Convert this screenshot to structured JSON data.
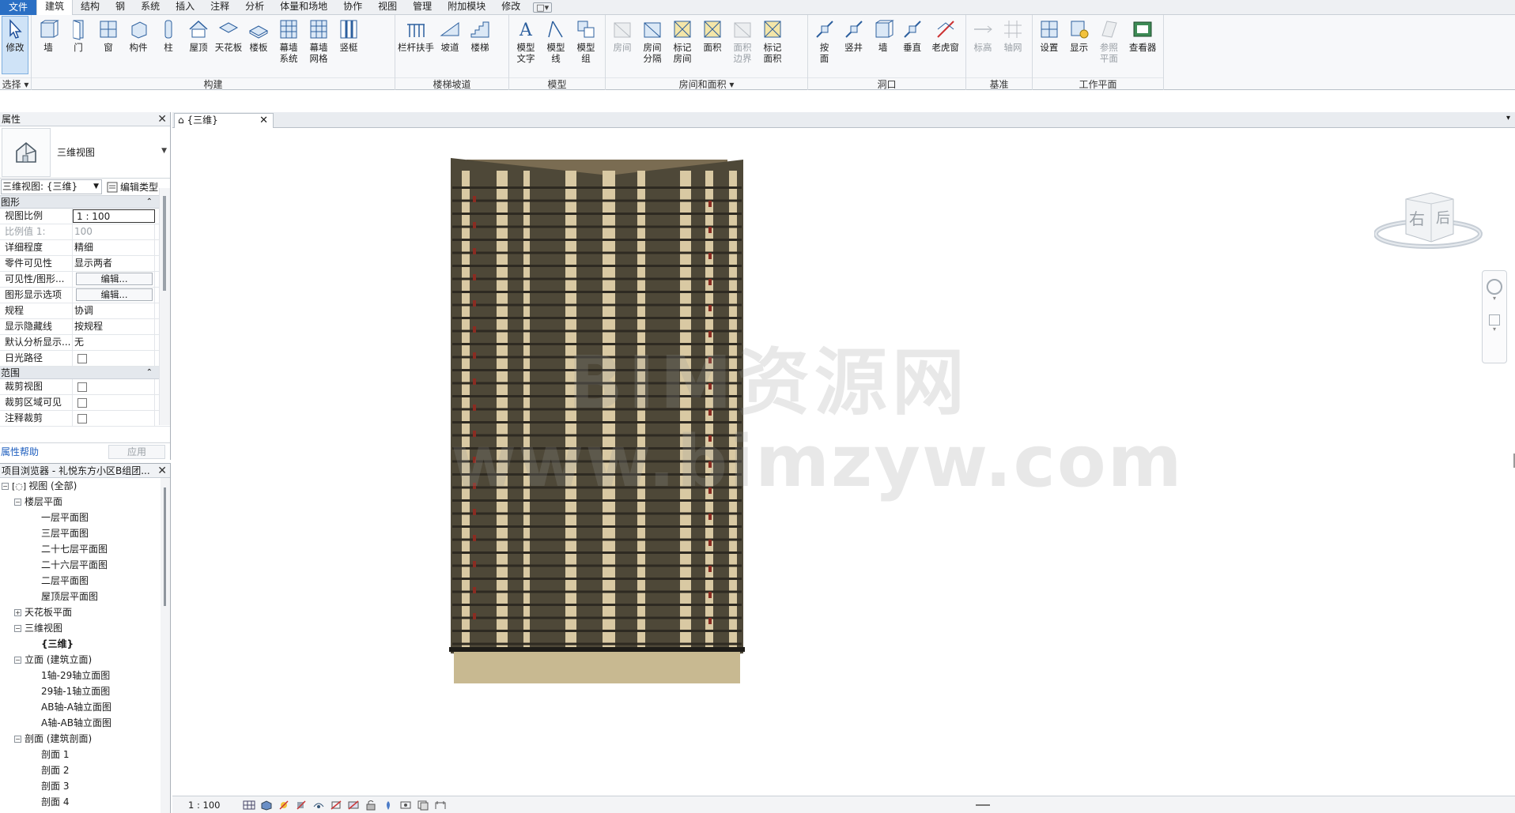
{
  "menu": {
    "file": "文件",
    "tabs": [
      "建筑",
      "结构",
      "钢",
      "系统",
      "插入",
      "注释",
      "分析",
      "体量和场地",
      "协作",
      "视图",
      "管理",
      "附加模块",
      "修改"
    ],
    "active": "建筑",
    "extra": "□▾"
  },
  "ribbon": {
    "select": {
      "modify": "修改",
      "label": "选择"
    },
    "build": {
      "title": "构建",
      "items": [
        "墙",
        "门",
        "窗",
        "构件",
        "柱",
        "屋顶",
        "天花板",
        "楼板",
        "幕墙\n系统",
        "幕墙\n网格",
        "竖梃"
      ]
    },
    "circulation": {
      "title": "楼梯坡道",
      "items": [
        "栏杆扶手",
        "坡道",
        "楼梯"
      ]
    },
    "model": {
      "title": "模型",
      "items": [
        "模型\n文字",
        "模型\n线",
        "模型\n组"
      ]
    },
    "room": {
      "title": "房间和面积",
      "items": [
        "房间",
        "房间\n分隔",
        "标记\n房间",
        "面积",
        "面积\n边界",
        "标记\n面积"
      ]
    },
    "opening": {
      "title": "洞口",
      "items": [
        "按\n面",
        "竖井",
        "墙",
        "垂直",
        "老虎窗"
      ]
    },
    "datum": {
      "title": "基准",
      "items": [
        "标高",
        "轴网"
      ]
    },
    "workplane": {
      "title": "工作平面",
      "items": [
        "设置",
        "显示",
        "参照\n平面",
        "查看器"
      ]
    }
  },
  "properties": {
    "title": "属性",
    "type_name": "三维视图",
    "instance": "三维视图: {三维}",
    "edit_type": "编辑类型",
    "sections": [
      {
        "name": "图形",
        "rows": [
          {
            "name": "视图比例",
            "value": "1 : 100",
            "kind": "input"
          },
          {
            "name": "比例值 1:",
            "value": "100",
            "kind": "dim"
          },
          {
            "name": "详细程度",
            "value": "精细",
            "kind": "text"
          },
          {
            "name": "零件可见性",
            "value": "显示两者",
            "kind": "text"
          },
          {
            "name": "可见性/图形...",
            "value": "编辑...",
            "kind": "button"
          },
          {
            "name": "图形显示选项",
            "value": "编辑...",
            "kind": "button"
          },
          {
            "name": "规程",
            "value": "协调",
            "kind": "text"
          },
          {
            "name": "显示隐藏线",
            "value": "按规程",
            "kind": "text"
          },
          {
            "name": "默认分析显示...",
            "value": "无",
            "kind": "text"
          },
          {
            "name": "日光路径",
            "value": "",
            "kind": "check"
          }
        ]
      },
      {
        "name": "范围",
        "rows": [
          {
            "name": "裁剪视图",
            "value": "",
            "kind": "check"
          },
          {
            "name": "裁剪区域可见",
            "value": "",
            "kind": "check"
          },
          {
            "name": "注释裁剪",
            "value": "",
            "kind": "check"
          }
        ]
      }
    ],
    "help": "属性帮助",
    "apply": "应用"
  },
  "browser": {
    "title": "项目浏览器 - 礼悦东方小区B组团...",
    "nodes": [
      {
        "label": "视图 (全部)",
        "level": 0,
        "toggle": "-",
        "bold": false,
        "icon": true
      },
      {
        "label": "楼层平面",
        "level": 1,
        "toggle": "-"
      },
      {
        "label": "一层平面图",
        "level": 2
      },
      {
        "label": "三层平面图",
        "level": 2
      },
      {
        "label": "二十七层平面图",
        "level": 2
      },
      {
        "label": "二十六层平面图",
        "level": 2
      },
      {
        "label": "二层平面图",
        "level": 2
      },
      {
        "label": "屋顶层平面图",
        "level": 2
      },
      {
        "label": "天花板平面",
        "level": 1,
        "toggle": "+"
      },
      {
        "label": "三维视图",
        "level": 1,
        "toggle": "-"
      },
      {
        "label": "{三维}",
        "level": 2,
        "bold": true
      },
      {
        "label": "立面 (建筑立面)",
        "level": 1,
        "toggle": "-"
      },
      {
        "label": "1轴-29轴立面图",
        "level": 2
      },
      {
        "label": "29轴-1轴立面图",
        "level": 2
      },
      {
        "label": "AB轴-A轴立面图",
        "level": 2
      },
      {
        "label": "A轴-AB轴立面图",
        "level": 2
      },
      {
        "label": "剖面 (建筑剖面)",
        "level": 1,
        "toggle": "-"
      },
      {
        "label": "剖面 1",
        "level": 2
      },
      {
        "label": "剖面 2",
        "level": 2
      },
      {
        "label": "剖面 3",
        "level": 2
      },
      {
        "label": "剖面 4",
        "level": 2
      }
    ]
  },
  "view": {
    "tab": "{三维}",
    "viewcube": {
      "face1": "右",
      "face2": "后"
    },
    "watermark1": "BIM资源网",
    "watermark2": "www.bimzyw.com",
    "scale": "1 : 100"
  },
  "colors": {
    "accent": "#2a6fc4",
    "facade_dark": "#4e4838",
    "facade_light": "#d9c9a3",
    "balcony_red": "#8a2c22"
  }
}
